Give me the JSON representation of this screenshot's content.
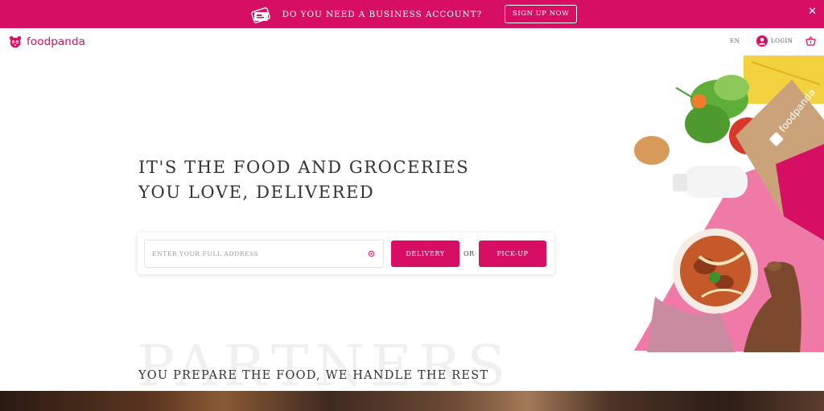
{
  "banner": {
    "text": "DO YOU NEED A BUSINESS ACCOUNT?",
    "cta_label": "SIGN UP NOW",
    "close_glyph": "✕",
    "icon": "business-card-icon",
    "background": "#d70f64"
  },
  "header": {
    "logo_text": "foodpanda",
    "logo_icon": "panda-icon",
    "language": "EN",
    "login_label": "LOGIN",
    "user_icon": "user-icon",
    "cart_icon": "basket-icon"
  },
  "hero": {
    "title_line1": "IT'S THE FOOD AND GROCERIES",
    "title_line2": "YOU LOVE, DELIVERED",
    "address_placeholder": "ENTER YOUR FULL ADDRESS",
    "address_value": "",
    "locate_icon": "locate-icon",
    "delivery_label": "DELIVERY",
    "or_label": "OR",
    "pickup_label": "PICK-UP",
    "bag_brand": "foodpanda"
  },
  "partners": {
    "background_word": "PARTNERS",
    "subtitle": "YOU PREPARE THE FOOD, WE HANDLE THE REST"
  },
  "colors": {
    "brand_pink": "#d70f64",
    "text_dark": "#333333"
  }
}
